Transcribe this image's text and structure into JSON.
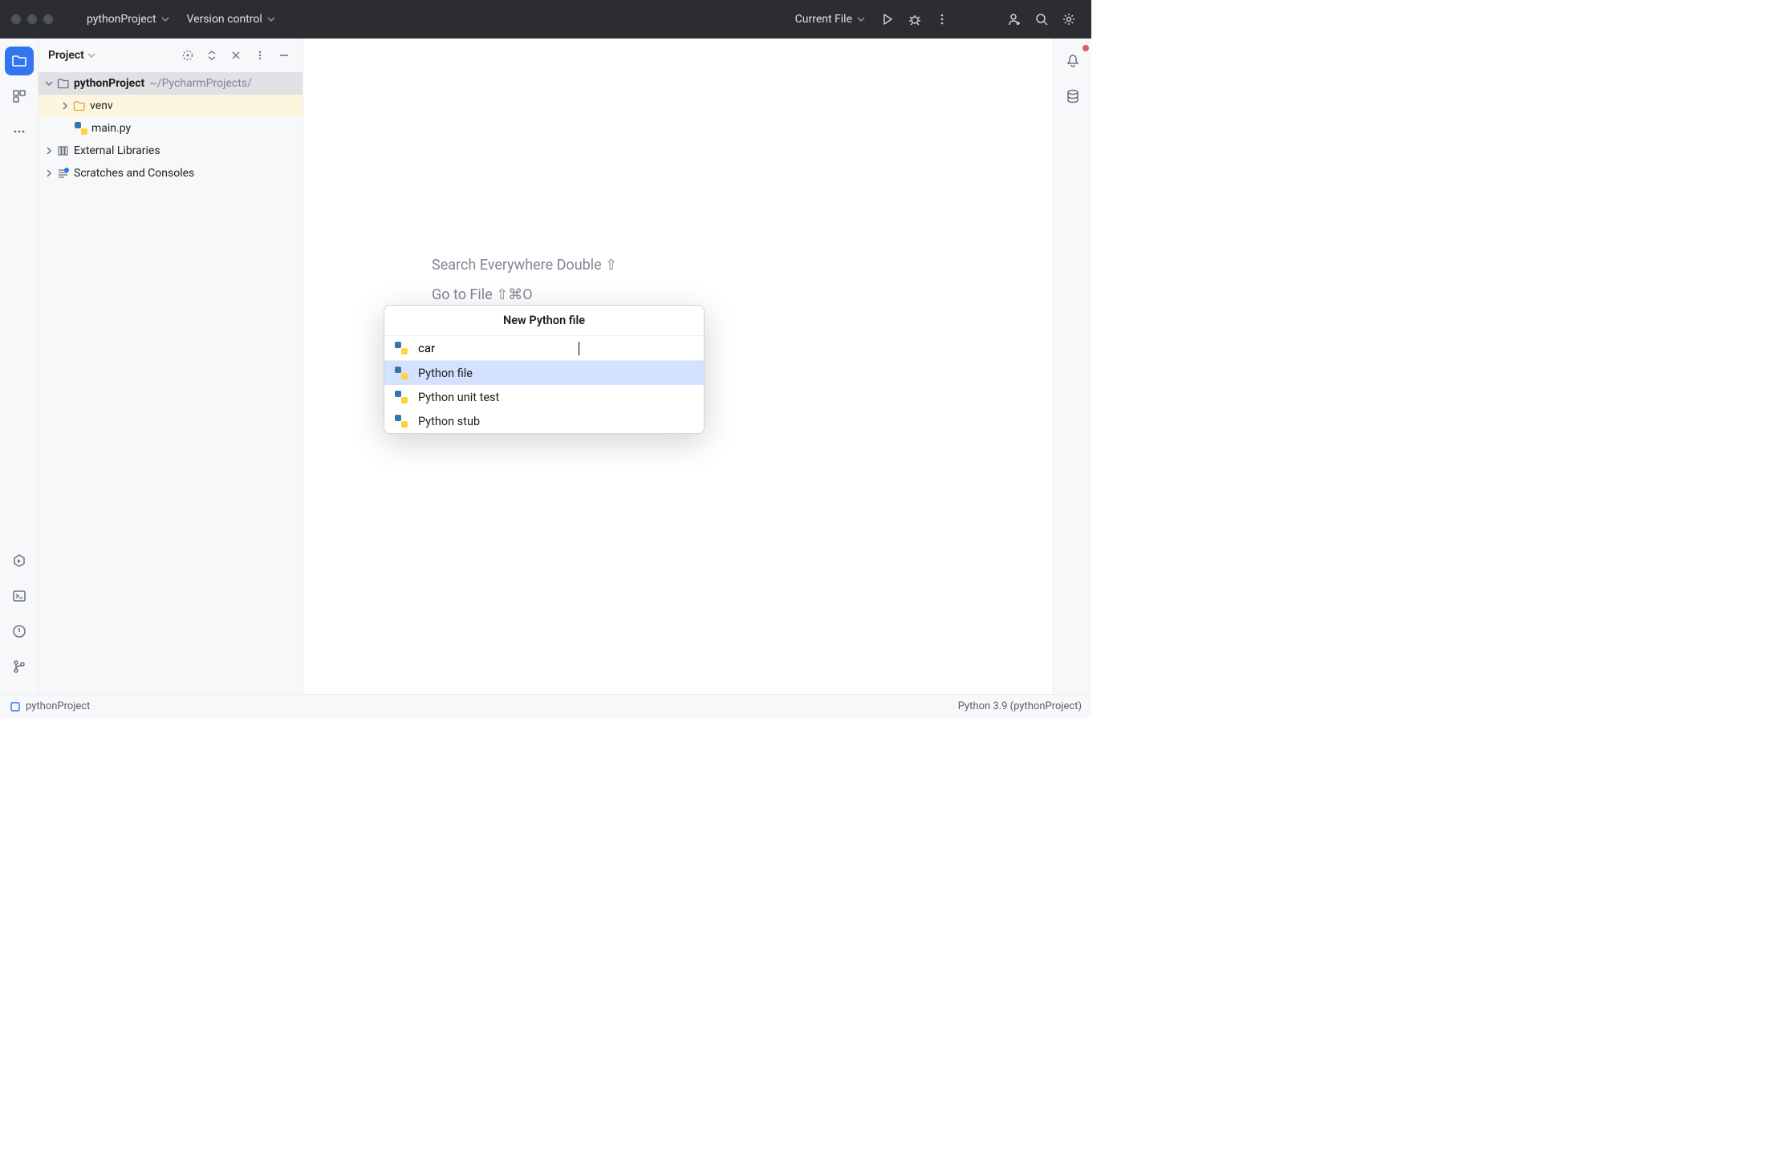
{
  "titlebar": {
    "project": "pythonProject",
    "vcs": "Version control",
    "runconfig": "Current File"
  },
  "project_panel": {
    "title": "Project",
    "tree": {
      "root": {
        "name": "pythonProject",
        "path": "~/PycharmProjects/"
      },
      "venv": "venv",
      "main": "main.py",
      "ext": "External Libraries",
      "scratches": "Scratches and Consoles"
    }
  },
  "editor_hints": {
    "search": "Search Everywhere Double ⇧",
    "goto": "Go to File ⇧⌘O"
  },
  "popup": {
    "title": "New Python file",
    "input_value": "car",
    "options": [
      "Python file",
      "Python unit test",
      "Python stub"
    ]
  },
  "statusbar": {
    "left": "pythonProject",
    "right": "Python 3.9 (pythonProject)"
  }
}
